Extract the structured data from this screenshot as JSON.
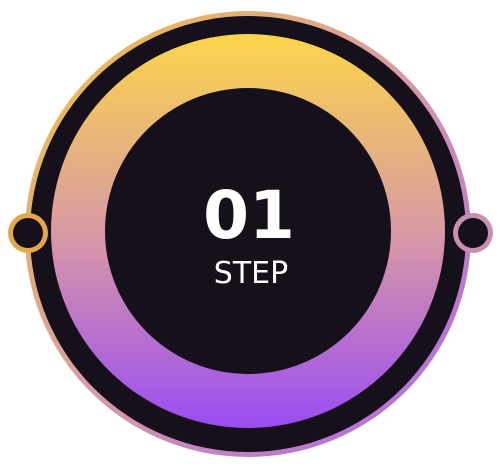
{
  "step": {
    "number": "01",
    "label": "STEP"
  },
  "colors": {
    "background": "#ffffff",
    "dark": "#15101a",
    "gradient_top": "#fcd54a",
    "gradient_mid": "#d89aa3",
    "gradient_bottom": "#9b4cf3",
    "text": "#ffffff"
  }
}
